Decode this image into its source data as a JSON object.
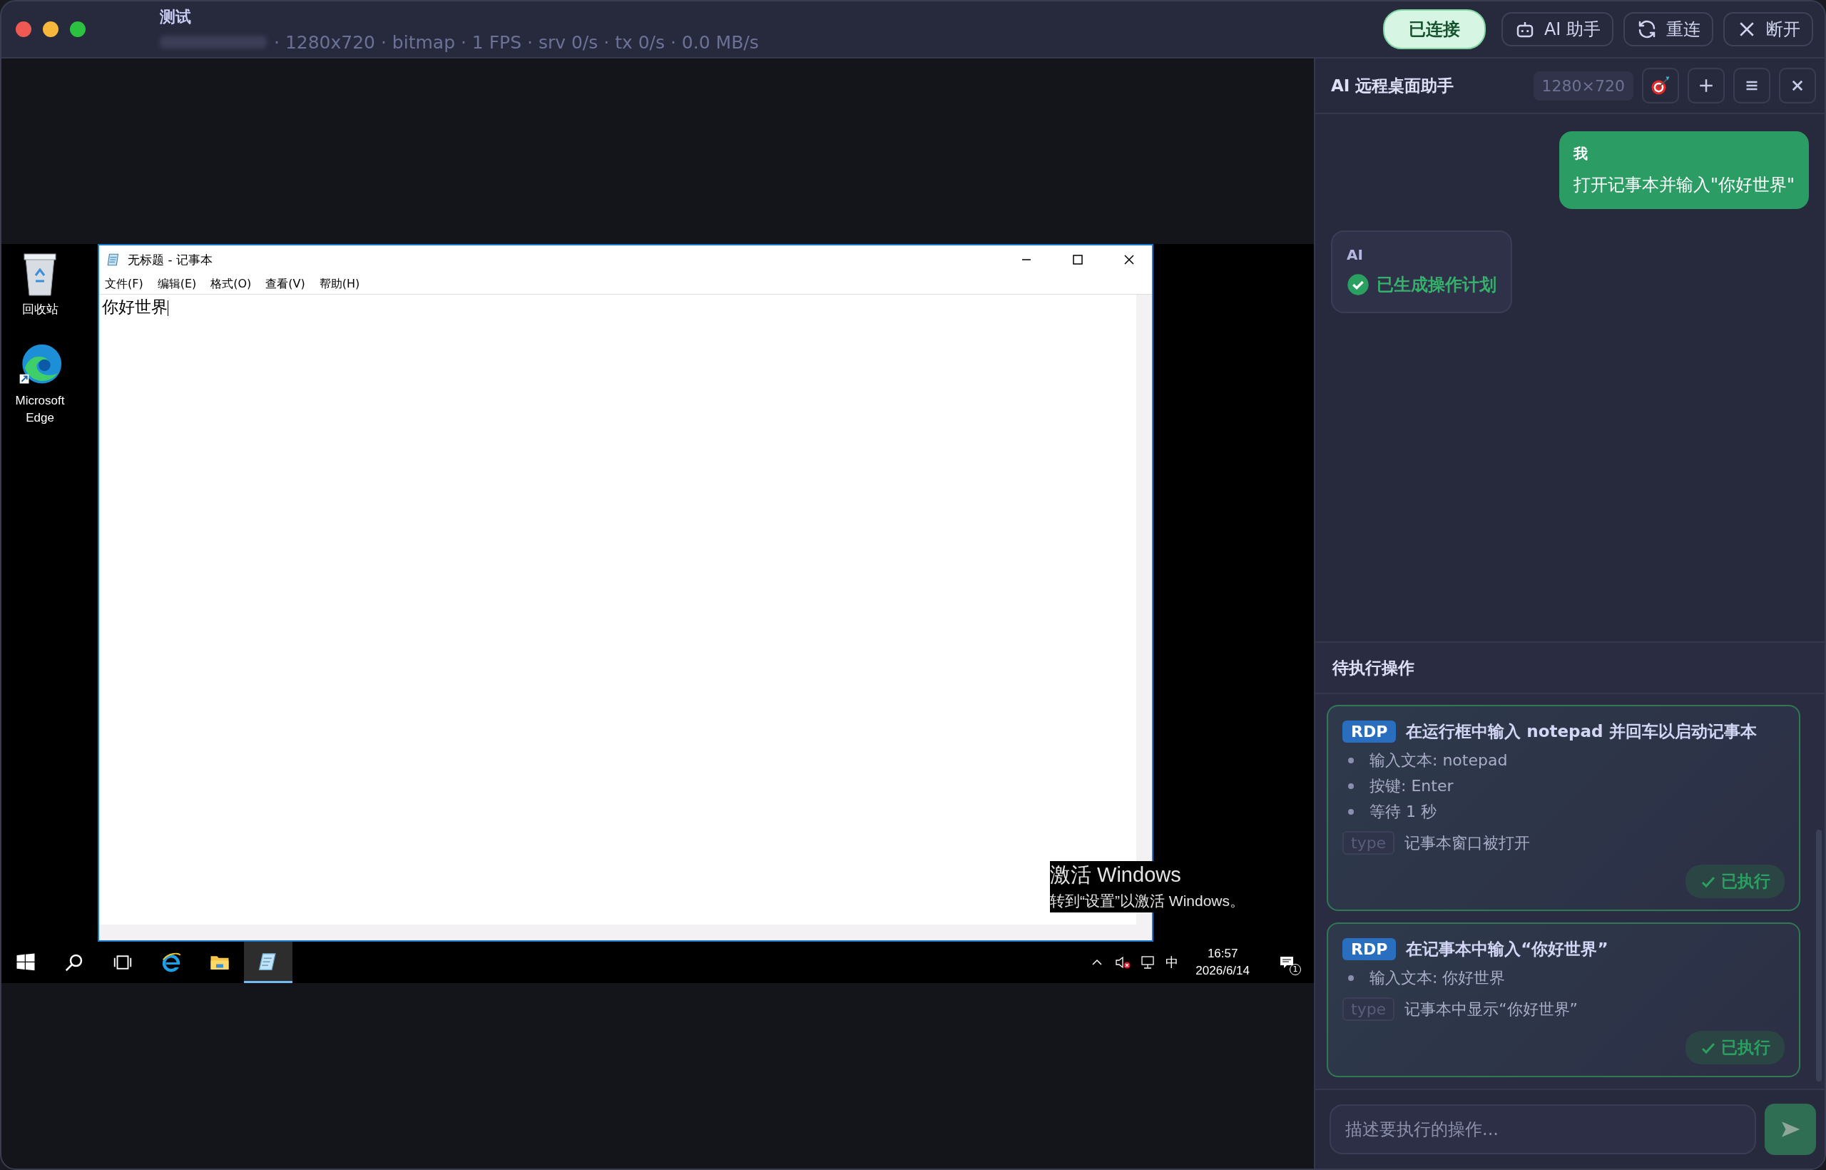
{
  "window": {
    "title": "测试",
    "status": "· 1280x720 · bitmap · 1 FPS · srv 0/s · tx 0/s · 0.0 MB/s",
    "connection": {
      "label": "已连接",
      "connected": true
    },
    "buttons": [
      {
        "kind": "assistant",
        "label": "AI 助手"
      },
      {
        "kind": "reconnect",
        "label": "重连"
      },
      {
        "kind": "disconnect",
        "label": "断开"
      }
    ]
  },
  "remote_desktop": {
    "desktop_icons": [
      {
        "kind": "recycle",
        "label": "回收站"
      },
      {
        "kind": "edge",
        "label": "Microsoft Edge"
      }
    ],
    "notepad": {
      "title": "无标题 - 记事本",
      "menu": [
        "文件(F)",
        "编辑(E)",
        "格式(O)",
        "查看(V)",
        "帮助(H)"
      ],
      "content": "你好世界"
    },
    "taskbar": {
      "items": [
        {
          "kind": "start",
          "selected": false
        },
        {
          "kind": "search",
          "selected": false
        },
        {
          "kind": "taskview",
          "selected": false
        },
        {
          "kind": "ie",
          "selected": false
        },
        {
          "kind": "explorer",
          "selected": false
        },
        {
          "kind": "notepad",
          "selected": true
        }
      ],
      "ime": "中",
      "time": "16:57",
      "date": "2026/6/14",
      "notifications": "1"
    },
    "activation": {
      "title": "激活 Windows",
      "hint": "转到“设置”以激活 Windows。"
    }
  },
  "assistant": {
    "title": "AI 远程桌面助手",
    "resolution": "1280×720",
    "tools": [
      {
        "kind": "target"
      },
      {
        "kind": "add"
      },
      {
        "kind": "menu"
      },
      {
        "kind": "close"
      }
    ],
    "messages": [
      {
        "kind": "user",
        "author": "我",
        "text": "打开记事本并输入\"你好世界\""
      },
      {
        "kind": "ai",
        "author": "AI",
        "status": "已生成操作计划"
      }
    ],
    "pending": {
      "title": "待执行操作",
      "actions": [
        {
          "tag": "RDP",
          "title": "在运行框中输入 notepad 并回车以启动记事本",
          "steps": [
            "输入文本: notepad",
            "按键: Enter",
            "等待 1 秒"
          ],
          "check_tag": "type",
          "check": "记事本窗口被打开",
          "status": "已执行",
          "done": true
        },
        {
          "tag": "RDP",
          "title": "在记事本中输入“你好世界”",
          "steps": [
            "输入文本: 你好世界"
          ],
          "check_tag": "type",
          "check": "记事本中显示“你好世界”",
          "status": "已执行",
          "done": true
        }
      ]
    },
    "input": {
      "placeholder": "描述要执行的操作..."
    }
  }
}
